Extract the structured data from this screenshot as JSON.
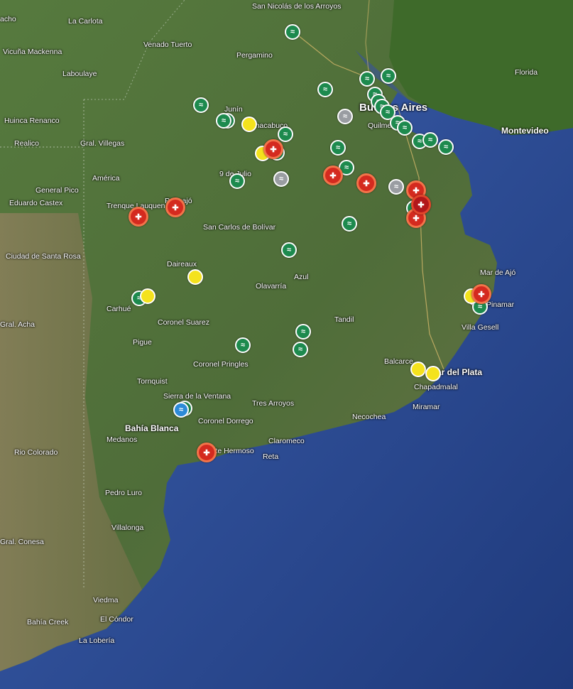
{
  "colors": {
    "land": "#4f6b3a",
    "ocean": "#2d4e95",
    "uruguay": "#3e6a2a",
    "marker_green": "#1d8a4e",
    "marker_yellow": "#f4e21d",
    "marker_red": "#d42a1f",
    "marker_gray": "#9a9da2",
    "marker_blue": "#2d8ad8"
  },
  "map": {
    "labels": [
      {
        "id": "la-carlota",
        "text": "La Carlota"
      },
      {
        "id": "venado-tuerto",
        "text": "Venado Tuerto"
      },
      {
        "id": "san-nicolas",
        "text": "San Nicolás de los Arroyos"
      },
      {
        "id": "vicuna-mackenna",
        "text": "Vicuña Mackenna"
      },
      {
        "id": "laboulaye",
        "text": "Laboulaye"
      },
      {
        "id": "pergamino",
        "text": "Pergamino"
      },
      {
        "id": "florida",
        "text": "Florida"
      },
      {
        "id": "huinca-renanco",
        "text": "Huinca Renanco"
      },
      {
        "id": "realico",
        "text": "Realico"
      },
      {
        "id": "gral-villegas",
        "text": "Gral. Villegas"
      },
      {
        "id": "junin",
        "text": "Junín"
      },
      {
        "id": "chacabuco",
        "text": "Chacabuco"
      },
      {
        "id": "buenos-aires",
        "text": "Buenos Aires"
      },
      {
        "id": "quilmes",
        "text": "Quilmes"
      },
      {
        "id": "montevideo",
        "text": "Montevideo"
      },
      {
        "id": "america",
        "text": "América"
      },
      {
        "id": "nueve-de-julio",
        "text": "9 de Julio"
      },
      {
        "id": "general-pico",
        "text": "General Pico"
      },
      {
        "id": "eduardo-castex",
        "text": "Eduardo Castex"
      },
      {
        "id": "trenque-lauquen",
        "text": "Trenque Lauquen"
      },
      {
        "id": "pehuajo",
        "text": "Pehuajó"
      },
      {
        "id": "san-carlos-bolivar",
        "text": "San Carlos de Bolívar"
      },
      {
        "id": "ciudad-santa-rosa",
        "text": "Ciudad de Santa Rosa"
      },
      {
        "id": "daireaux",
        "text": "Daireaux"
      },
      {
        "id": "olavarria",
        "text": "Olavarría"
      },
      {
        "id": "azul",
        "text": "Azul"
      },
      {
        "id": "mar-de-ajo",
        "text": "Mar de Ajó"
      },
      {
        "id": "pinamar",
        "text": "Pinamar"
      },
      {
        "id": "carhue",
        "text": "Carhué"
      },
      {
        "id": "coronel-suarez",
        "text": "Coronel Suarez"
      },
      {
        "id": "tandil",
        "text": "Tandil"
      },
      {
        "id": "villa-gesell",
        "text": "Villa Gesell"
      },
      {
        "id": "gral-acha",
        "text": "Gral. Acha"
      },
      {
        "id": "pigue",
        "text": "Pigue"
      },
      {
        "id": "coronel-pringles",
        "text": "Coronel Pringles"
      },
      {
        "id": "balcarce",
        "text": "Balcarce"
      },
      {
        "id": "mar-del-plata",
        "text": "Mar del Plata"
      },
      {
        "id": "tornquist",
        "text": "Tornquist"
      },
      {
        "id": "chapadmalal",
        "text": "Chapadmalal"
      },
      {
        "id": "sierra-ventana",
        "text": "Sierra de la Ventana"
      },
      {
        "id": "tres-arroyos",
        "text": "Tres Arroyos"
      },
      {
        "id": "miramar",
        "text": "Miramar"
      },
      {
        "id": "necochea",
        "text": "Necochea"
      },
      {
        "id": "bahia-blanca",
        "text": "Bahía Blanca"
      },
      {
        "id": "medanos",
        "text": "Medanos"
      },
      {
        "id": "coronel-dorrego",
        "text": "Coronel Dorrego"
      },
      {
        "id": "claromeco",
        "text": "Claromeco"
      },
      {
        "id": "rio-colorado",
        "text": "Rio Colorado"
      },
      {
        "id": "monte-hermoso",
        "text": "Monte Hermoso"
      },
      {
        "id": "reta",
        "text": "Reta"
      },
      {
        "id": "pedro-luro",
        "text": "Pedro Luro"
      },
      {
        "id": "villalonga",
        "text": "Villalonga"
      },
      {
        "id": "gral-conesa",
        "text": "Gral. Conesa"
      },
      {
        "id": "viedma",
        "text": "Viedma"
      },
      {
        "id": "bahia-creek",
        "text": "Bahía Creek"
      },
      {
        "id": "el-condor",
        "text": "El Cóndor"
      },
      {
        "id": "la-loberia",
        "text": "La Lobería"
      },
      {
        "id": "alcho",
        "text": "acho"
      }
    ],
    "markers": [
      {
        "type": "green"
      },
      {
        "type": "green"
      },
      {
        "type": "green"
      },
      {
        "type": "green"
      },
      {
        "type": "green"
      },
      {
        "type": "green"
      },
      {
        "type": "green"
      },
      {
        "type": "green"
      },
      {
        "type": "green"
      },
      {
        "type": "green"
      },
      {
        "type": "green"
      },
      {
        "type": "green"
      },
      {
        "type": "green"
      },
      {
        "type": "green"
      },
      {
        "type": "green"
      },
      {
        "type": "green"
      },
      {
        "type": "green"
      },
      {
        "type": "green"
      },
      {
        "type": "green"
      },
      {
        "type": "green"
      },
      {
        "type": "green"
      },
      {
        "type": "green"
      },
      {
        "type": "green"
      },
      {
        "type": "green"
      },
      {
        "type": "green"
      },
      {
        "type": "green"
      },
      {
        "type": "green"
      },
      {
        "type": "green"
      },
      {
        "type": "green"
      },
      {
        "type": "green"
      },
      {
        "type": "green"
      },
      {
        "type": "yellow"
      },
      {
        "type": "yellow"
      },
      {
        "type": "yellow"
      },
      {
        "type": "yellow"
      },
      {
        "type": "yellow"
      },
      {
        "type": "yellow"
      },
      {
        "type": "yellow"
      },
      {
        "type": "gray"
      },
      {
        "type": "gray"
      },
      {
        "type": "gray"
      },
      {
        "type": "blue"
      },
      {
        "type": "red"
      },
      {
        "type": "red"
      },
      {
        "type": "red"
      },
      {
        "type": "red"
      },
      {
        "type": "red"
      },
      {
        "type": "red"
      },
      {
        "type": "red"
      },
      {
        "type": "darkred"
      },
      {
        "type": "red"
      },
      {
        "type": "red"
      }
    ]
  }
}
